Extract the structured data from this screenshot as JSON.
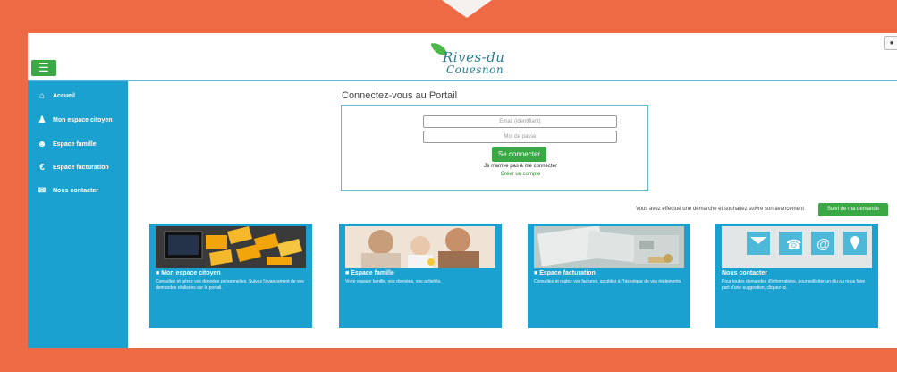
{
  "header": {
    "logo_line1": "Rives-du",
    "logo_line2": "Couesnon",
    "menu_icon": "hamburger-icon",
    "user_icon": "user-icon"
  },
  "sidebar": {
    "items": [
      {
        "label": "Accueil",
        "icon": "home-icon"
      },
      {
        "label": "Mon espace citoyen",
        "icon": "person-icon"
      },
      {
        "label": "Espace famille",
        "icon": "family-icon"
      },
      {
        "label": "Espace facturation",
        "icon": "euro-icon"
      },
      {
        "label": "Nous contacter",
        "icon": "envelope-icon"
      }
    ]
  },
  "login": {
    "title": "Connectez-vous au Portail",
    "email_placeholder": "Email (identifiant)",
    "password_placeholder": "Mot de passe",
    "submit_label": "Se connecter",
    "forgot_label": "Je n'arrive pas à me connecter",
    "create_label": "Créer un compte"
  },
  "demarche": {
    "text": "Vous avez effectué une démarche et souhaitez suivre son avancement",
    "button_label": "Suivi de ma demande"
  },
  "cards": [
    {
      "title": "Mon espace citoyen",
      "lock": true,
      "desc": "Consultez et gérez vos données personnelles. Suivez l'avancement de vos demandes réalisées sur le portail."
    },
    {
      "title": "Espace famille",
      "lock": true,
      "desc": "Votre espace famille, vos données, vos activités."
    },
    {
      "title": "Espace facturation",
      "lock": true,
      "desc": "Consultez et réglez vos factures, accédez à l'historique de vos règlements."
    },
    {
      "title": "Nous contacter",
      "lock": false,
      "desc": "Pour toutes demandes d'informations, pour solliciter un élu ou nous faire part d'une suggestion, cliquez-ici."
    }
  ],
  "colors": {
    "accent_blue": "#1aa1cf",
    "accent_green": "#3aa844",
    "frame_orange": "#ee6a45"
  }
}
